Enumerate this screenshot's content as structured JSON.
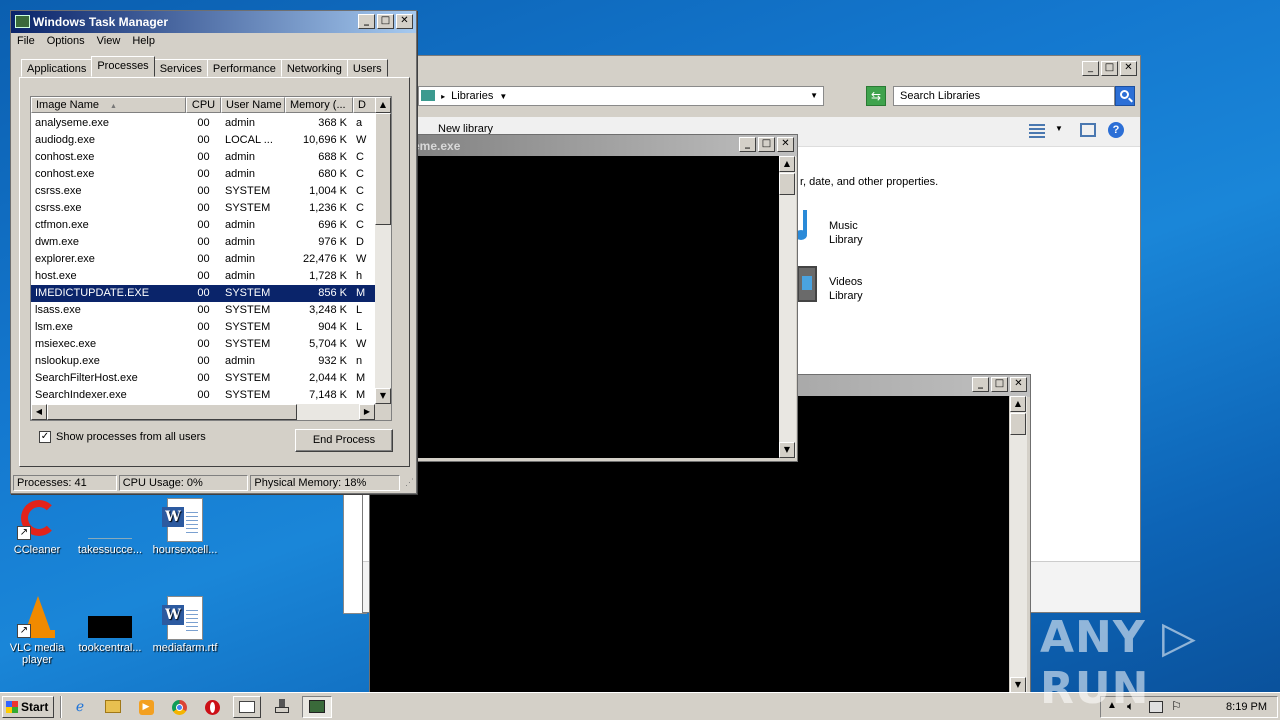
{
  "desktop": {
    "icons": [
      {
        "label": "CCleaner"
      },
      {
        "label": "takessucce..."
      },
      {
        "label": "hoursexcell..."
      },
      {
        "label": "VLC media player"
      },
      {
        "label": "tookcentral..."
      },
      {
        "label": "mediafarm.rtf"
      }
    ],
    "watermark": "ANY RUN"
  },
  "task_manager": {
    "title": "Windows Task Manager",
    "menu": [
      "File",
      "Options",
      "View",
      "Help"
    ],
    "tabs": [
      "Applications",
      "Processes",
      "Services",
      "Performance",
      "Networking",
      "Users"
    ],
    "active_tab": "Processes",
    "columns": [
      "Image Name",
      "CPU",
      "User Name",
      "Memory (...",
      "D"
    ],
    "processes": [
      {
        "name": "analyseme.exe",
        "cpu": "00",
        "user": "admin",
        "mem": "368 K",
        "desc": "a"
      },
      {
        "name": "audiodg.exe",
        "cpu": "00",
        "user": "LOCAL ...",
        "mem": "10,696 K",
        "desc": "W"
      },
      {
        "name": "conhost.exe",
        "cpu": "00",
        "user": "admin",
        "mem": "688 K",
        "desc": "C"
      },
      {
        "name": "conhost.exe",
        "cpu": "00",
        "user": "admin",
        "mem": "680 K",
        "desc": "C"
      },
      {
        "name": "csrss.exe",
        "cpu": "00",
        "user": "SYSTEM",
        "mem": "1,004 K",
        "desc": "C"
      },
      {
        "name": "csrss.exe",
        "cpu": "00",
        "user": "SYSTEM",
        "mem": "1,236 K",
        "desc": "C"
      },
      {
        "name": "ctfmon.exe",
        "cpu": "00",
        "user": "admin",
        "mem": "696 K",
        "desc": "C"
      },
      {
        "name": "dwm.exe",
        "cpu": "00",
        "user": "admin",
        "mem": "976 K",
        "desc": "D"
      },
      {
        "name": "explorer.exe",
        "cpu": "00",
        "user": "admin",
        "mem": "22,476 K",
        "desc": "W"
      },
      {
        "name": "host.exe",
        "cpu": "00",
        "user": "admin",
        "mem": "1,728 K",
        "desc": "h"
      },
      {
        "name": "IMEDICTUPDATE.EXE",
        "cpu": "00",
        "user": "SYSTEM",
        "mem": "856 K",
        "desc": "M"
      },
      {
        "name": "lsass.exe",
        "cpu": "00",
        "user": "SYSTEM",
        "mem": "3,248 K",
        "desc": "L"
      },
      {
        "name": "lsm.exe",
        "cpu": "00",
        "user": "SYSTEM",
        "mem": "904 K",
        "desc": "L"
      },
      {
        "name": "msiexec.exe",
        "cpu": "00",
        "user": "SYSTEM",
        "mem": "5,704 K",
        "desc": "W"
      },
      {
        "name": "nslookup.exe",
        "cpu": "00",
        "user": "admin",
        "mem": "932 K",
        "desc": "n"
      },
      {
        "name": "SearchFilterHost.exe",
        "cpu": "00",
        "user": "SYSTEM",
        "mem": "2,044 K",
        "desc": "M"
      },
      {
        "name": "SearchIndexer.exe",
        "cpu": "00",
        "user": "SYSTEM",
        "mem": "7,148 K",
        "desc": "M"
      }
    ],
    "show_all_label": "Show processes from all users",
    "show_all_checked": true,
    "end_process_label": "End Process",
    "status": {
      "processes": "Processes: 41",
      "cpu": "CPU Usage: 0%",
      "memory": "Physical Memory: 18%"
    }
  },
  "explorer": {
    "breadcrumb": "Libraries",
    "search_placeholder": "Search Libraries",
    "new_library": "New library",
    "description": "r, date, and other properties.",
    "libraries": [
      {
        "name": "Music",
        "sub": "Library"
      },
      {
        "name": "Videos",
        "sub": "Library"
      }
    ]
  },
  "console1": {
    "title": "eme.exe"
  },
  "taskbar": {
    "start_label": "Start",
    "clock": "8:19 PM"
  }
}
